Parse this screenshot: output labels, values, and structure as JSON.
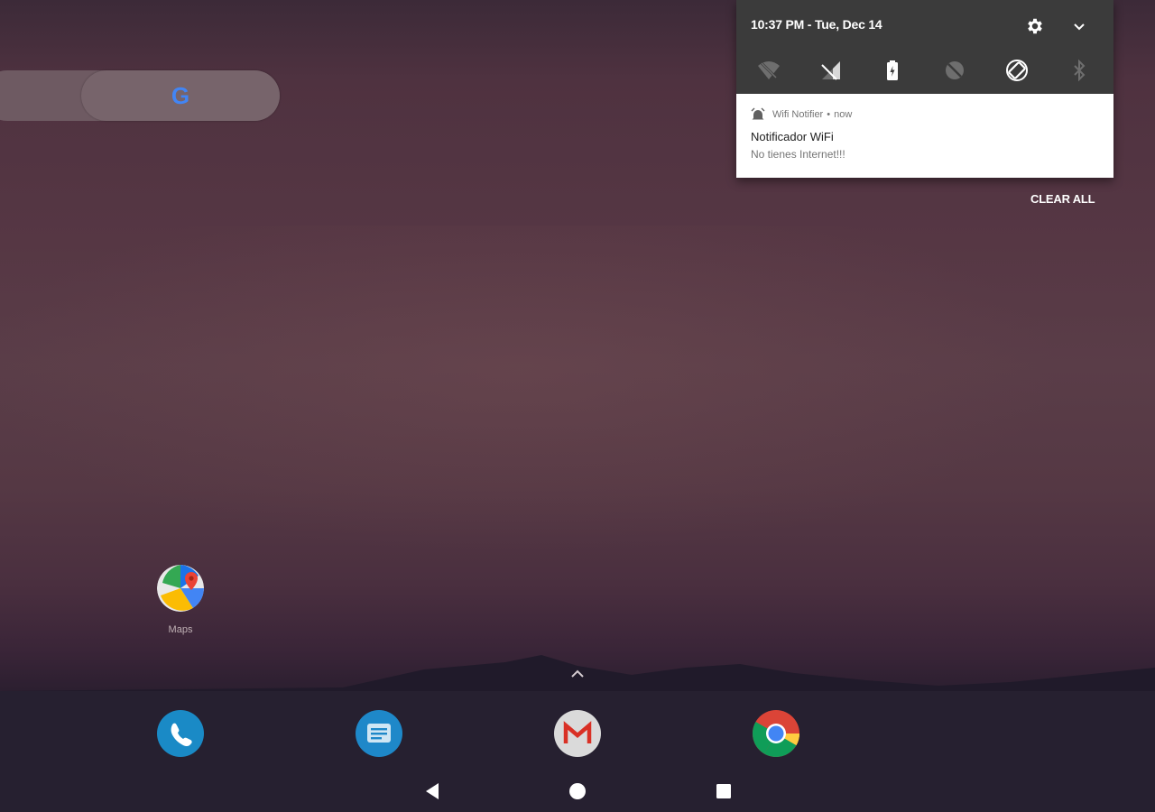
{
  "search": {
    "logo_text": "G",
    "logo_color": "#4285f4"
  },
  "home": {
    "apps": [
      {
        "label": "Maps",
        "icon": "maps-icon"
      }
    ],
    "drawer_icon": "chevron-up-icon"
  },
  "dock": {
    "apps": [
      {
        "name": "phone",
        "icon": "phone-icon",
        "color": "#1a8ac6"
      },
      {
        "name": "messages",
        "icon": "messages-icon",
        "color": "#1e88c9"
      },
      {
        "name": "gmail",
        "icon": "gmail-icon",
        "color": "#e0e0e0"
      },
      {
        "name": "chrome",
        "icon": "chrome-icon",
        "color": "#db4437"
      }
    ]
  },
  "nav": {
    "back_icon": "back-icon",
    "home_icon": "home-icon",
    "recents_icon": "recents-icon"
  },
  "shade": {
    "datetime": "10:37 PM - Tue, Dec 14",
    "settings_icon": "gear-icon",
    "expand_icon": "chevron-down-icon",
    "quick_tiles": [
      "wifi-off-icon",
      "cellular-off-icon",
      "battery-icon",
      "do-not-disturb-icon",
      "auto-rotate-icon",
      "bluetooth-off-icon"
    ]
  },
  "notification": {
    "app_name": "Wifi Notifier",
    "separator": "•",
    "time": "now",
    "title": "Notificador WiFi",
    "text": "No tienes Internet!!!",
    "icon": "alarm-icon"
  },
  "clear_all_label": "CLEAR ALL"
}
